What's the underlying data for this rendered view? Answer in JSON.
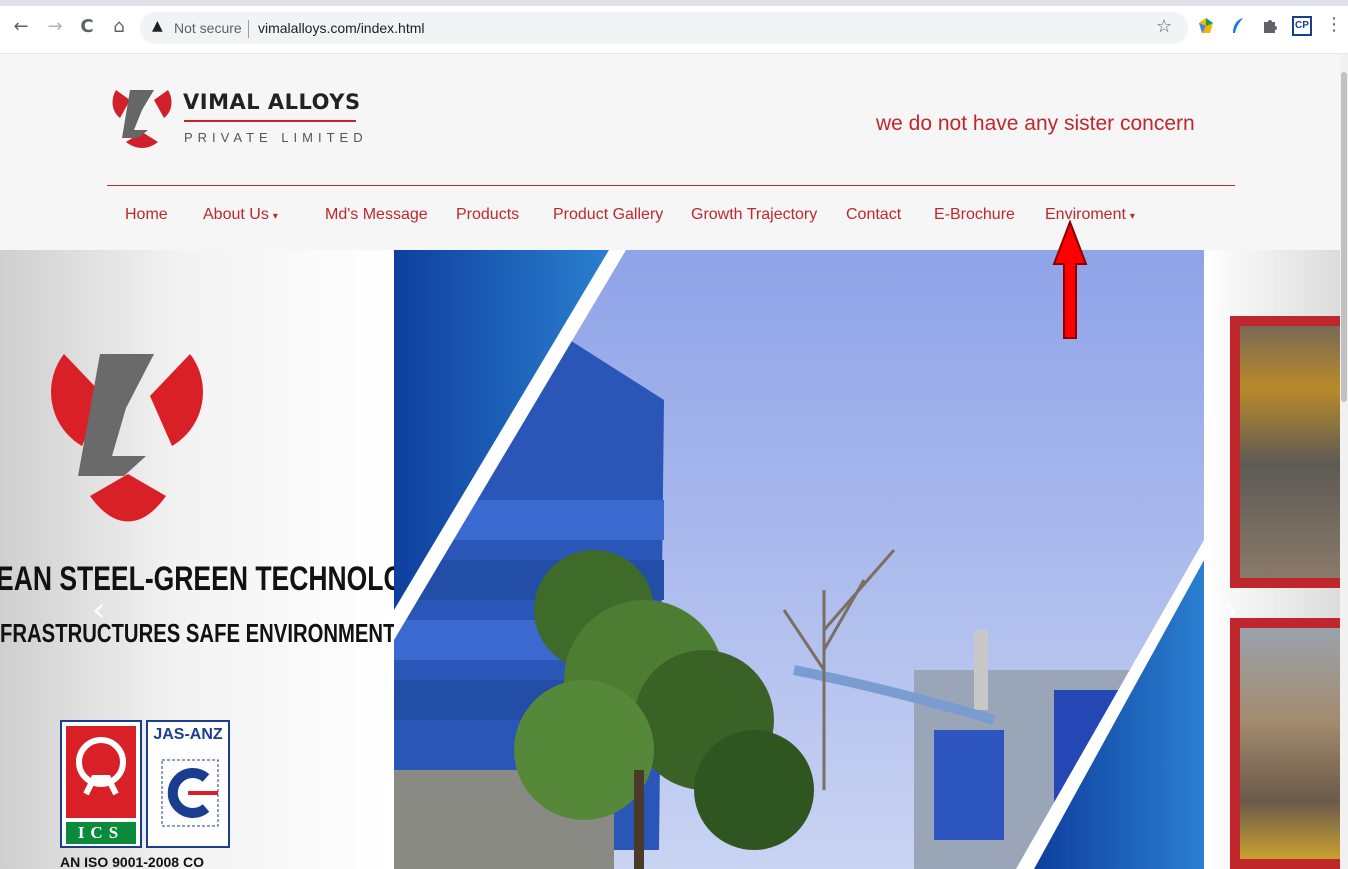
{
  "browser": {
    "back_icon": "←",
    "forward_icon": "→",
    "reload_icon": "C",
    "home_icon": "⌂",
    "warning_icon": "▲",
    "security_label": "Not secure",
    "url": "vimalalloys.com/index.html",
    "star_icon": "☆",
    "extensions": [
      "map-extension-icon",
      "feather-extension-icon",
      "puzzle-extension-icon",
      "cp-extension-icon"
    ],
    "cp_label": "CP",
    "menu_icon": "⋮"
  },
  "header": {
    "brand_name": "VIMAL ALLOYS",
    "brand_sub": "PRIVATE LIMITED",
    "tagline": "we do not have any sister concern"
  },
  "nav": {
    "items": [
      {
        "label": "Home",
        "dropdown": false
      },
      {
        "label": "About Us",
        "dropdown": true
      },
      {
        "label": "Md's Message",
        "dropdown": false
      },
      {
        "label": "Products",
        "dropdown": false
      },
      {
        "label": "Product Gallery",
        "dropdown": false
      },
      {
        "label": "Growth Trajectory",
        "dropdown": false
      },
      {
        "label": "Contact",
        "dropdown": false
      },
      {
        "label": "E-Brochure",
        "dropdown": false
      },
      {
        "label": "Enviroment",
        "dropdown": true
      }
    ],
    "caret": "▾"
  },
  "slider": {
    "heading_line1": "EAN STEEL-GREEN TECHNOLOGY",
    "heading_line2": "FRASTRUCTURES SAFE ENVIRONMENT",
    "cert_badge_left": "ICS",
    "cert_badge_right": "JAS-ANZ",
    "cert_caption": "AN ISO 9001-2008 CO",
    "prev_icon": "‹",
    "next_icon": "›"
  },
  "colors": {
    "brand_red": "#c0272d",
    "nav_text": "#c0272d",
    "header_bg": "#f6f6f6",
    "annotation_arrow": "#ff0000"
  }
}
